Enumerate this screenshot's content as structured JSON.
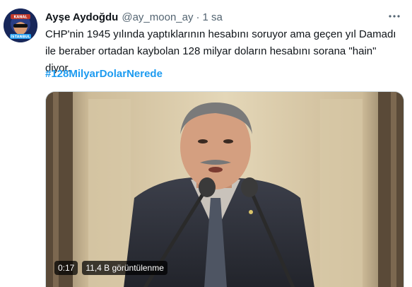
{
  "tweet": {
    "author": {
      "display_name": "Ayşe Aydoğdu",
      "handle": "@ay_moon_ay",
      "separator": "·",
      "time": "1 sa",
      "avatar_text_top": "KANAL",
      "avatar_text_bottom": "İSTANBUL"
    },
    "more_icon": "ellipsis-icon",
    "text": "CHP'nin 1945 yılında yaptıklarının hesabını soruyor ama geçen yıl Damadı ile beraber ortadan kaybolan 128 milyar doların hesabını sorana \"hain\" diyor.",
    "hashtag": "#128MilyarDolarNerede",
    "video": {
      "duration": "0:17",
      "views": "11,4 B görüntülenme"
    }
  },
  "colors": {
    "link": "#1d9bf0",
    "secondary_text": "#536471",
    "primary_text": "#0f1419"
  }
}
